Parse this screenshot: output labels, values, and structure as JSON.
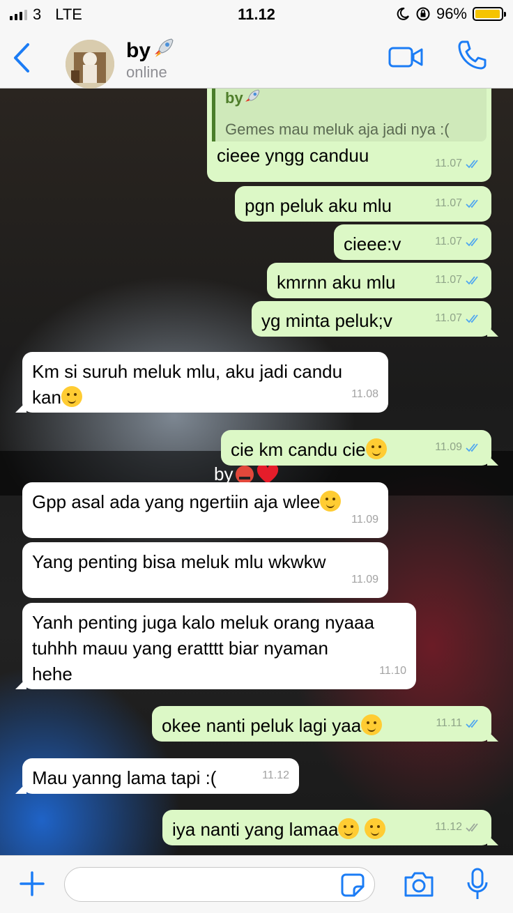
{
  "status_bar": {
    "carrier": "3",
    "network": "LTE",
    "time": "11.12",
    "battery": "96%",
    "battery_level": 0.96
  },
  "header": {
    "contact_name": "by",
    "presence": "online",
    "name_emoji": "rocket"
  },
  "quote": {
    "author": "by",
    "text": "Gemes mau meluk aja jadi nya :("
  },
  "messages": [
    {
      "dir": "out",
      "text": "cieee yngg canduu",
      "time": "11.07",
      "status": "read"
    },
    {
      "dir": "out",
      "text": "pgn peluk aku mlu",
      "time": "11.07",
      "status": "read"
    },
    {
      "dir": "out",
      "text": "cieee:v",
      "time": "11.07",
      "status": "read"
    },
    {
      "dir": "out",
      "text": "kmrnn aku mlu",
      "time": "11.07",
      "status": "read"
    },
    {
      "dir": "out",
      "text": "yg minta peluk;v",
      "time": "11.07",
      "status": "read"
    },
    {
      "dir": "in",
      "text": "Km si suruh meluk mlu, aku jadi candu\nkan",
      "time": "11.08",
      "emoji": "grinning-sweat"
    },
    {
      "dir": "out",
      "text": "cie km candu cie",
      "time": "11.09",
      "status": "read",
      "emoji": "kissing"
    },
    {
      "dir": "in",
      "text": "Gpp asal ada yang ngertiin aja wlee",
      "time": "11.09",
      "emoji": "yum"
    },
    {
      "dir": "in",
      "text": "Yang penting bisa meluk mlu wkwkw",
      "time": "11.09"
    },
    {
      "dir": "in",
      "text": "Yanh penting juga kalo meluk orang nyaaa\ntuhhh mauu yang eratttt biar nyaman\nhehe",
      "time": "11.10"
    },
    {
      "dir": "out",
      "text": "okee nanti peluk lagi yaa",
      "time": "11.11",
      "status": "read",
      "emoji": "kissing"
    },
    {
      "dir": "in",
      "text": "Mau yanng lama tapi :(",
      "time": "11.12"
    },
    {
      "dir": "out",
      "text": "iya nanti yang lamaa",
      "time": "11.12",
      "status": "delivered",
      "emoji": "hugging kissing"
    }
  ],
  "background_overlay": {
    "text": "by"
  },
  "input": {
    "placeholder": ""
  },
  "colors": {
    "accent": "#1b7cf5",
    "outgoing_bubble": "#dcf8c6",
    "incoming_bubble": "#ffffff",
    "read_tick": "#4fa6f0",
    "battery": "#f5c400"
  }
}
